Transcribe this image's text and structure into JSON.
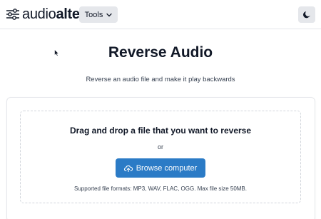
{
  "header": {
    "logo": {
      "light": "audio",
      "bold": "alter",
      "icon": "sliders-icon"
    },
    "tools_label": "Tools",
    "tools_icon": "chevron-down-icon",
    "theme_icon": "moon-icon"
  },
  "main": {
    "title": "Reverse Audio",
    "subtitle": "Reverse an audio file and make it play backwards"
  },
  "upload": {
    "heading": "Drag and drop a file that you want to reverse",
    "or_text": "or",
    "browse_label": "Browse computer",
    "browse_icon": "cloud-upload-icon",
    "formats_text": "Supported file formats: MP3, WAV, FLAC, OGG. Max file size 50MB."
  },
  "colors": {
    "accent": "#2b7bc6",
    "button_bg": "#e5e7eb",
    "border": "#e5e7eb"
  }
}
